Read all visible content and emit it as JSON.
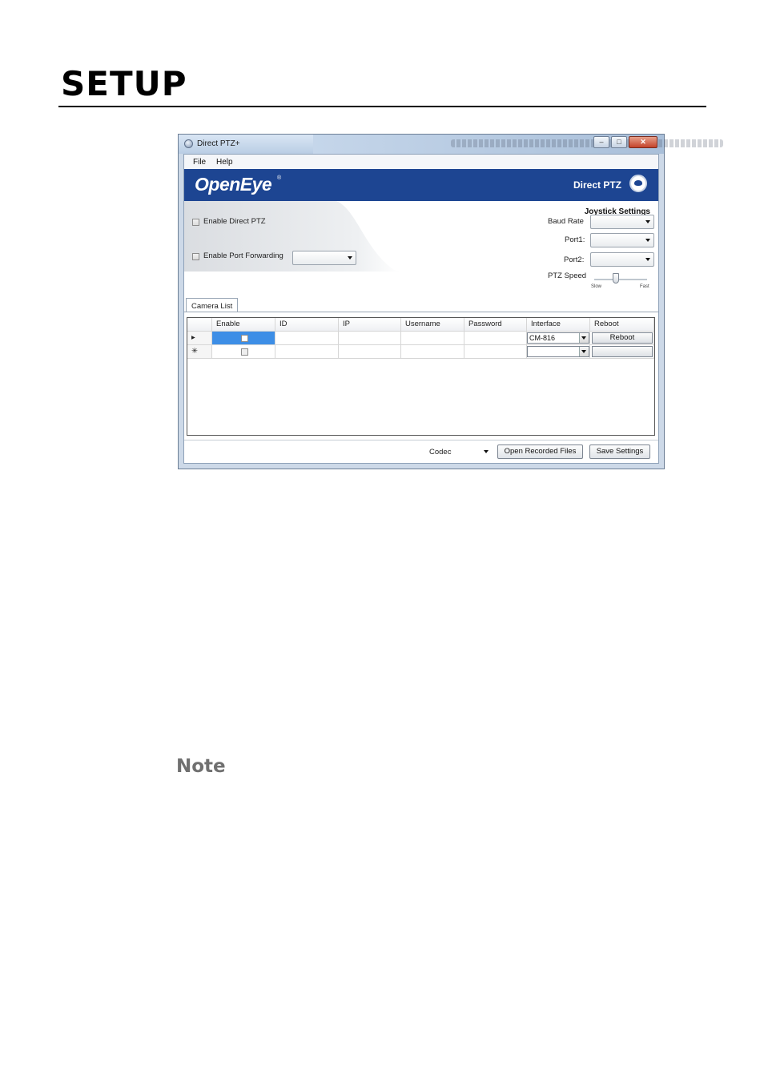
{
  "page": {
    "title": "SETUP",
    "note_heading": "Note"
  },
  "window": {
    "title": "Direct PTZ+",
    "menu": [
      "File",
      "Help"
    ],
    "brand": "OpenEye",
    "brand_mark": "®",
    "banner_title": "Direct PTZ",
    "controls": {
      "minimize": "–",
      "maximize": "□",
      "close": "✕"
    }
  },
  "options": {
    "enable_direct_ptz": {
      "label": "Enable Direct PTZ",
      "checked": false
    },
    "enable_port_forwarding": {
      "label": "Enable Port Forwarding",
      "checked": false,
      "value": ""
    }
  },
  "joystick": {
    "title": "Joystick Settings",
    "baud_rate": {
      "label": "Baud Rate",
      "value": ""
    },
    "port1": {
      "label": "Port1:",
      "value": ""
    },
    "port2": {
      "label": "Port2:",
      "value": ""
    },
    "ptz_speed": {
      "label": "PTZ Speed",
      "slow": "Slow",
      "fast": "Fast",
      "level": 0.4
    }
  },
  "camera_list": {
    "tab": "Camera List",
    "columns": [
      "Enable",
      "ID",
      "IP",
      "Username",
      "Password",
      "Interface",
      "Reboot"
    ],
    "rows": [
      {
        "marker": "▸",
        "enable": false,
        "id": "",
        "ip": "",
        "username": "",
        "password": "",
        "interface": "CM-816",
        "reboot": "Reboot"
      },
      {
        "marker": "✳",
        "enable": false,
        "id": "",
        "ip": "",
        "username": "",
        "password": "",
        "interface": "",
        "reboot": ""
      }
    ]
  },
  "footer": {
    "codec_label": "Codec",
    "open_recorded_files": "Open Recorded Files",
    "save_settings": "Save Settings"
  },
  "colors": {
    "banner": "#1d4592",
    "selection": "#3d8ee6"
  },
  "icons": [
    "app-icon",
    "ptz-camera-icon",
    "chevron-down-icon"
  ]
}
